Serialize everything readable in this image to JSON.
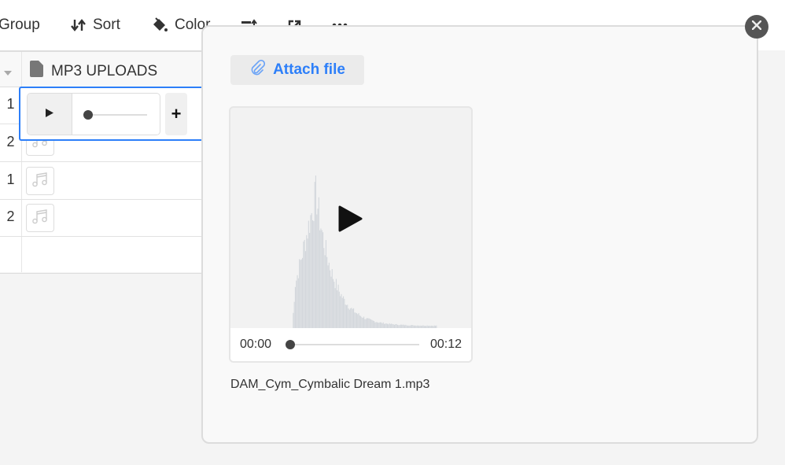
{
  "toolbar": {
    "items": [
      {
        "label": "Group",
        "icon": "group-icon"
      },
      {
        "label": "Sort",
        "icon": "sort-icon"
      },
      {
        "label": "Color",
        "icon": "paint-bucket-icon"
      },
      {
        "label": "",
        "icon": "row-height-icon"
      },
      {
        "label": "",
        "icon": "share-view-icon"
      },
      {
        "label": "",
        "icon": "more-icon"
      }
    ]
  },
  "grid": {
    "column_header": "MP3 UPLOADS",
    "rows": [
      {
        "number": "1",
        "has_player": true
      },
      {
        "number": "2"
      },
      {
        "number": "1"
      },
      {
        "number": "2"
      }
    ],
    "add_label": "+"
  },
  "modal": {
    "attach_label": "Attach file",
    "file": {
      "name": "DAM_Cym_Cymbalic Dream 1.mp3",
      "current_time": "00:00",
      "duration": "00:12",
      "progress": 0
    }
  },
  "colors": {
    "accent": "#2d7ff9",
    "waveform": "#d3d7dc"
  }
}
